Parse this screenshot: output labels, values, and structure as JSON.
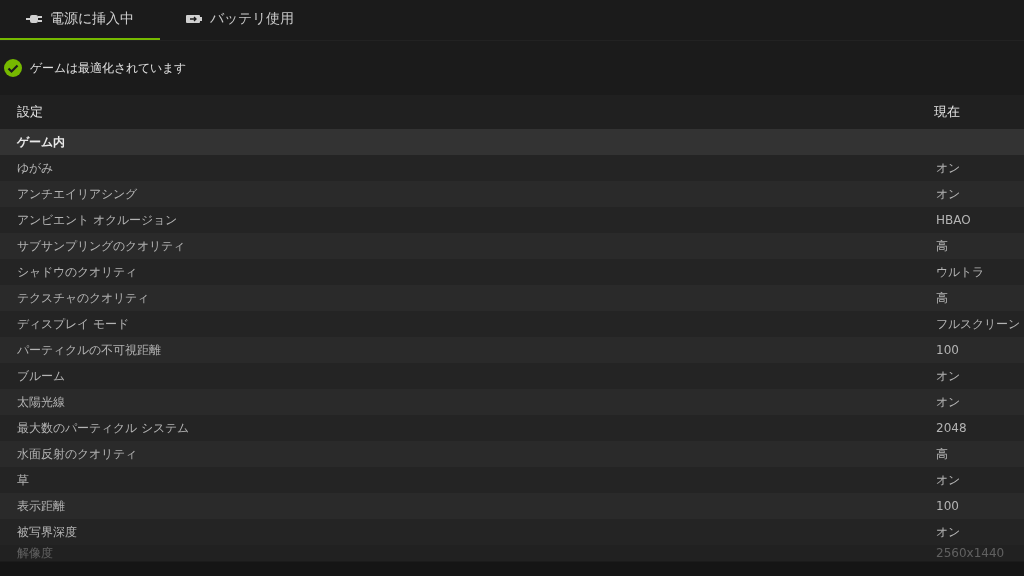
{
  "tabs": [
    {
      "label": "電源に挿入中",
      "kind": "plug",
      "selected": true
    },
    {
      "label": "バッテリ使用",
      "kind": "battery",
      "selected": false
    }
  ],
  "status": {
    "text": "ゲームは最適化されています",
    "optimized": true
  },
  "table": {
    "columns": [
      "設定",
      "現在"
    ],
    "rows": [
      {
        "kind": "group",
        "setting": "ゲーム内"
      },
      {
        "kind": "item",
        "setting": "ゆがみ",
        "current": "オン"
      },
      {
        "kind": "item",
        "setting": "アンチエイリアシング",
        "current": "オン"
      },
      {
        "kind": "item",
        "setting": "アンビエント オクルージョン",
        "current": "HBAO"
      },
      {
        "kind": "item",
        "setting": "サブサンプリングのクオリティ",
        "current": "高"
      },
      {
        "kind": "item",
        "setting": "シャドウのクオリティ",
        "current": "ウルトラ"
      },
      {
        "kind": "item",
        "setting": "テクスチャのクオリティ",
        "current": "高"
      },
      {
        "kind": "item",
        "setting": "ディスプレイ モード",
        "current": "フルスクリーン"
      },
      {
        "kind": "item",
        "setting": "パーティクルの不可視距離",
        "current": "100"
      },
      {
        "kind": "item",
        "setting": "ブルーム",
        "current": "オン"
      },
      {
        "kind": "item",
        "setting": "太陽光線",
        "current": "オン"
      },
      {
        "kind": "item",
        "setting": "最大数のパーティクル システム",
        "current": "2048"
      },
      {
        "kind": "item",
        "setting": "水面反射のクオリティ",
        "current": "高"
      },
      {
        "kind": "item",
        "setting": "草",
        "current": "オン"
      },
      {
        "kind": "item",
        "setting": "表示距離",
        "current": "100"
      },
      {
        "kind": "item",
        "setting": "被写界深度",
        "current": "オン"
      },
      {
        "kind": "faded",
        "setting": "解像度",
        "current": "2560x1440"
      }
    ]
  }
}
